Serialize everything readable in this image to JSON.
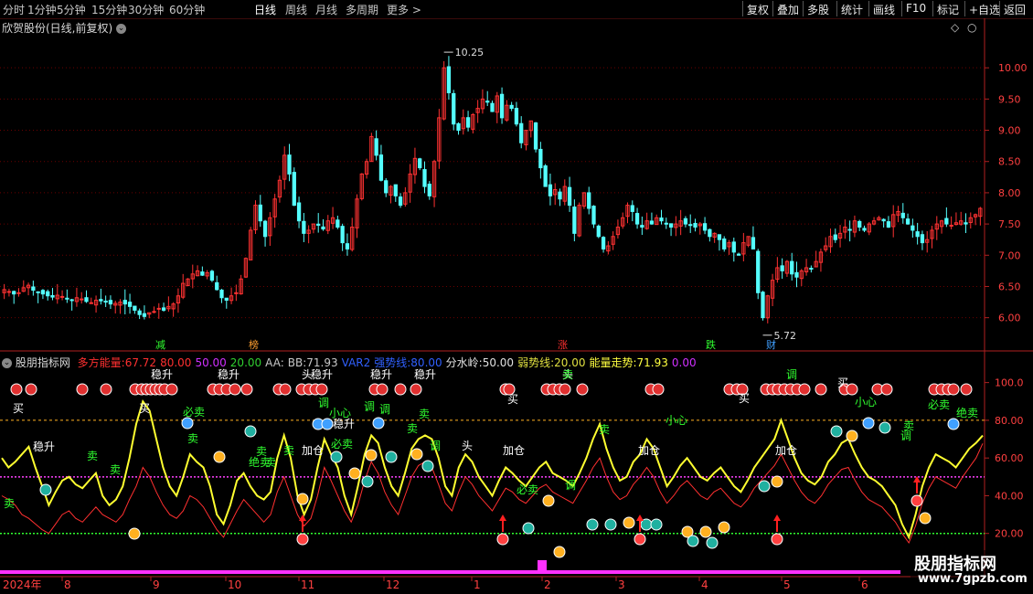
{
  "toolbar": {
    "periods": [
      "分时",
      "1分钟",
      "5分钟",
      "15分钟",
      "30分钟",
      "60分钟",
      "日线",
      "周线",
      "月线",
      "多周期",
      "更多 >"
    ],
    "active_period": "日线",
    "buttons": [
      "复权",
      "叠加",
      "多股",
      "统计",
      "画线",
      "F10",
      "标记",
      "+自选",
      "返回"
    ]
  },
  "main_title": "欣贺股份(日线,前复权)",
  "indicator_header": {
    "name": "股朋指标网",
    "items": [
      {
        "label": "多方能量:",
        "value": "67.72",
        "color": "#ff3030"
      },
      {
        "label": "",
        "value": "80.00",
        "color": "#ff3030"
      },
      {
        "label": "",
        "value": "50.00",
        "color": "#d030ff"
      },
      {
        "label": "",
        "value": "20.00",
        "color": "#30d030"
      },
      {
        "label": "AA:",
        "value": "",
        "color": "#c8c8c8"
      },
      {
        "label": "BB:",
        "value": "71.93",
        "color": "#c8c8c8"
      },
      {
        "label": "VAR2",
        "value": "",
        "color": "#3060ff"
      },
      {
        "label": "强势线:",
        "value": "80.00",
        "color": "#3060ff"
      },
      {
        "label": "分水岭:",
        "value": "50.00",
        "color": "#e0e0e0"
      },
      {
        "label": "弱势线:",
        "value": "20.00",
        "color": "#e0e040"
      },
      {
        "label": "能量走势:",
        "value": "71.93",
        "color": "#ffff40"
      },
      {
        "label": "",
        "value": "0.00",
        "color": "#d030ff"
      }
    ]
  },
  "colors": {
    "up": "#ff3232",
    "down": "#54ffff",
    "grid": "#6a0000",
    "axis": "#b02020",
    "energy": "#ffff30",
    "power": "#ff3030",
    "mid": "#ff40ff",
    "low": "#30ff30",
    "high": "#ffb020"
  },
  "price_axis_labels": [
    "10.00",
    "9.50",
    "9.00",
    "8.50",
    "8.00",
    "7.50",
    "7.00",
    "6.50",
    "6.00"
  ],
  "price_max_label": "10.25",
  "price_min_label": "5.72",
  "ind_axis_labels": [
    "100.0",
    "80.00",
    "60.00",
    "40.00",
    "20.00"
  ],
  "event_tags": [
    {
      "text": "减",
      "color": "#30ff30"
    },
    {
      "text": "榜",
      "color": "#ff9f30"
    },
    {
      "text": "涨",
      "color": "#ff3030"
    },
    {
      "text": "跌",
      "color": "#30ff30"
    },
    {
      "text": "财",
      "color": "#40a0ff"
    }
  ],
  "time_axis": {
    "year": "2024年",
    "months": [
      "8",
      "9",
      "10",
      "11",
      "12",
      "1",
      "2",
      "3",
      "4",
      "5",
      "6"
    ]
  },
  "ind_labels": [
    "稳升",
    "稳升",
    "头",
    "稳升",
    "稳升",
    "稳升",
    "头",
    "买",
    "买",
    "买",
    "调",
    "小心",
    "调",
    "必卖",
    "卖",
    "稳升",
    "买",
    "卖",
    "必卖",
    "加仓",
    "加仓",
    "加仓",
    "加仓",
    "卖",
    "卖",
    "卖",
    "绝卖",
    "卖",
    "卖",
    "调",
    "头",
    "稳升",
    "调",
    "卖",
    "调",
    "必卖",
    "小心",
    "卖",
    "调",
    "买",
    "小心",
    "必卖",
    "绝卖",
    "卖",
    "调",
    "卖",
    "卖"
  ],
  "watermark": {
    "title": "股朋指标网",
    "url": "www.7gpzb.com"
  },
  "chart_data": {
    "type": "candlestick+line",
    "price_panel": {
      "title": "欣贺股份(日线,前复权)",
      "ylim": [
        5.6,
        10.5
      ],
      "high_point": 10.25,
      "low_point": 5.72,
      "close_series": [
        6.45,
        6.42,
        6.38,
        6.4,
        6.48,
        6.52,
        6.44,
        6.4,
        6.38,
        6.35,
        6.33,
        6.36,
        6.34,
        6.3,
        6.28,
        6.32,
        6.3,
        6.26,
        6.24,
        6.28,
        6.27,
        6.25,
        6.22,
        6.23,
        6.25,
        6.22,
        6.18,
        6.12,
        6.05,
        6.02,
        6.08,
        6.1,
        6.15,
        6.12,
        6.18,
        6.22,
        6.35,
        6.55,
        6.62,
        6.7,
        6.75,
        6.68,
        6.72,
        6.6,
        6.45,
        6.32,
        6.28,
        6.35,
        6.4,
        6.62,
        6.95,
        7.4,
        7.8,
        7.55,
        7.3,
        7.6,
        7.9,
        8.2,
        8.6,
        8.3,
        7.8,
        7.55,
        7.35,
        7.4,
        7.5,
        7.48,
        7.42,
        7.55,
        7.6,
        7.45,
        7.2,
        7.1,
        7.45,
        7.9,
        8.3,
        8.5,
        8.9,
        8.6,
        8.2,
        8.0,
        8.1,
        7.95,
        7.8,
        8.0,
        8.3,
        8.55,
        8.4,
        8.1,
        7.95,
        8.5,
        9.2,
        10.0,
        9.6,
        9.1,
        9.0,
        9.2,
        9.05,
        9.25,
        9.35,
        9.5,
        9.45,
        9.3,
        9.55,
        9.2,
        9.4,
        9.35,
        9.1,
        8.8,
        9.0,
        9.15,
        8.7,
        8.4,
        8.1,
        7.95,
        8.05,
        7.9,
        8.1,
        7.8,
        7.35,
        7.8,
        8.0,
        7.75,
        7.5,
        7.3,
        7.1,
        7.15,
        7.3,
        7.45,
        7.6,
        7.8,
        7.7,
        7.5,
        7.45,
        7.55,
        7.5,
        7.6,
        7.55,
        7.5,
        7.45,
        7.5,
        7.55,
        7.5,
        7.48,
        7.45,
        7.5,
        7.4,
        7.3,
        7.35,
        7.25,
        7.1,
        7.2,
        7.05,
        7.0,
        7.2,
        7.3,
        7.1,
        6.4,
        6.0,
        6.35,
        6.6,
        6.8,
        6.75,
        6.9,
        6.7,
        6.65,
        6.75,
        6.8,
        6.78,
        6.9,
        7.05,
        7.15,
        7.3,
        7.25,
        7.35,
        7.45,
        7.4,
        7.55,
        7.45,
        7.4,
        7.5,
        7.55,
        7.6,
        7.55,
        7.45,
        7.65,
        7.7,
        7.6,
        7.5,
        7.4,
        7.3,
        7.2,
        7.25,
        7.4,
        7.5,
        7.55,
        7.5,
        7.48,
        7.52,
        7.55,
        7.5,
        7.6,
        7.65,
        7.75
      ]
    },
    "indicator_panel": {
      "ylim": [
        0,
        110
      ],
      "levels": {
        "strong": 80,
        "divide": 50,
        "weak": 20
      },
      "series": [
        {
          "name": "能量走势",
          "values": [
            60,
            55,
            58,
            62,
            66,
            55,
            45,
            35,
            42,
            48,
            50,
            46,
            44,
            48,
            52,
            40,
            35,
            38,
            45,
            60,
            78,
            90,
            85,
            70,
            55,
            45,
            40,
            50,
            62,
            58,
            55,
            45,
            30,
            25,
            35,
            48,
            52,
            45,
            40,
            38,
            42,
            60,
            72,
            60,
            40,
            30,
            38,
            55,
            70,
            62,
            55,
            40,
            30,
            45,
            62,
            72,
            68,
            55,
            45,
            40,
            52,
            65,
            70,
            72,
            70,
            60,
            45,
            40,
            55,
            62,
            58,
            50,
            45,
            40,
            48,
            55,
            52,
            48,
            45,
            50,
            55,
            58,
            52,
            50,
            48,
            45,
            52,
            60,
            70,
            78,
            65,
            55,
            48,
            50,
            58,
            62,
            70,
            65,
            55,
            45,
            50,
            56,
            60,
            55,
            50,
            48,
            52,
            55,
            50,
            45,
            42,
            48,
            55,
            60,
            65,
            70,
            80,
            70,
            60,
            52,
            48,
            46,
            50,
            58,
            62,
            68,
            70,
            62,
            55,
            50,
            48,
            45,
            40,
            35,
            25,
            18,
            30,
            45,
            55,
            62,
            60,
            58,
            55,
            60,
            65,
            68,
            71.93
          ]
        },
        {
          "name": "多方能量",
          "values": [
            40,
            38,
            35,
            30,
            28,
            25,
            22,
            20,
            25,
            30,
            32,
            28,
            26,
            30,
            34,
            30,
            28,
            26,
            30,
            38,
            45,
            55,
            50,
            42,
            35,
            30,
            28,
            32,
            40,
            38,
            34,
            28,
            22,
            18,
            25,
            32,
            38,
            34,
            30,
            26,
            30,
            42,
            50,
            40,
            30,
            24,
            28,
            40,
            55,
            48,
            40,
            32,
            26,
            35,
            48,
            58,
            52,
            42,
            35,
            30,
            40,
            50,
            56,
            58,
            55,
            46,
            36,
            32,
            42,
            50,
            46,
            40,
            36,
            32,
            38,
            44,
            42,
            38,
            36,
            40,
            44,
            46,
            42,
            40,
            38,
            36,
            42,
            48,
            55,
            60,
            50,
            42,
            38,
            40,
            46,
            50,
            55,
            50,
            42,
            36,
            40,
            45,
            48,
            44,
            40,
            38,
            42,
            44,
            40,
            36,
            34,
            38,
            44,
            48,
            52,
            56,
            62,
            55,
            48,
            42,
            38,
            36,
            40,
            46,
            50,
            54,
            55,
            48,
            42,
            38,
            36,
            34,
            30,
            26,
            20,
            15,
            24,
            36,
            44,
            50,
            48,
            46,
            44,
            50,
            55,
            60,
            67.72
          ]
        }
      ],
      "reference_lines": [
        80.0,
        50.0,
        20.0
      ]
    },
    "legend": "top-left",
    "grid": true
  }
}
